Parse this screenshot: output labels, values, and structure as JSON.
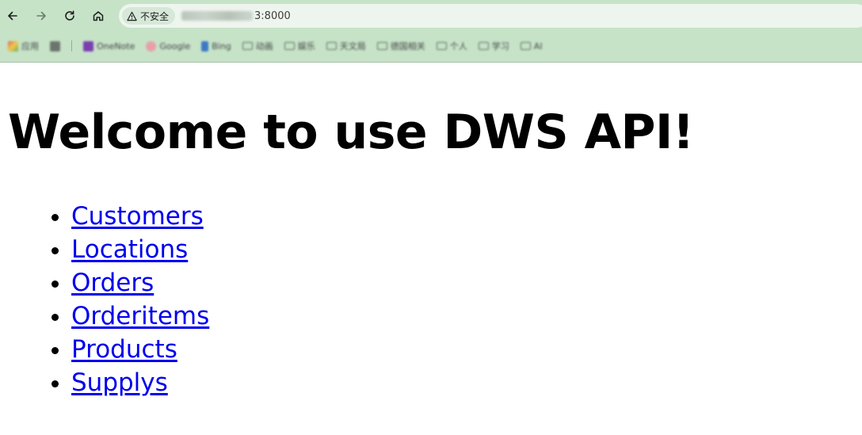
{
  "browser": {
    "nav": {
      "back_icon": "arrow-left-icon",
      "forward_icon": "arrow-right-icon",
      "reload_icon": "reload-icon",
      "home_icon": "home-icon"
    },
    "security_label": "不安全",
    "url_visible": "3:8000",
    "bookmarks": [
      {
        "label": "应用",
        "icon": "apps-icon"
      },
      {
        "label": "",
        "icon": "grid-icon"
      },
      {
        "label": "OneNote",
        "icon": "onenote-icon"
      },
      {
        "label": "Google",
        "icon": "google-icon"
      },
      {
        "label": "Bing",
        "icon": "bing-icon"
      },
      {
        "label": "动画",
        "icon": "folder-icon"
      },
      {
        "label": "娱乐",
        "icon": "folder-icon"
      },
      {
        "label": "天文局",
        "icon": "folder-icon"
      },
      {
        "label": "德国相关",
        "icon": "folder-icon"
      },
      {
        "label": "个人",
        "icon": "folder-icon"
      },
      {
        "label": "学习",
        "icon": "folder-icon"
      },
      {
        "label": "AI",
        "icon": "folder-icon"
      }
    ],
    "colors": {
      "chrome_bg": "#c6e3c8",
      "omnibox_bg": "#eef5ee"
    }
  },
  "page": {
    "title": "Welcome to use DWS API!",
    "links": [
      {
        "label": "Customers"
      },
      {
        "label": "Locations"
      },
      {
        "label": "Orders"
      },
      {
        "label": "Orderitems"
      },
      {
        "label": "Products"
      },
      {
        "label": "Supplys"
      }
    ],
    "link_color": "#0000ee"
  }
}
